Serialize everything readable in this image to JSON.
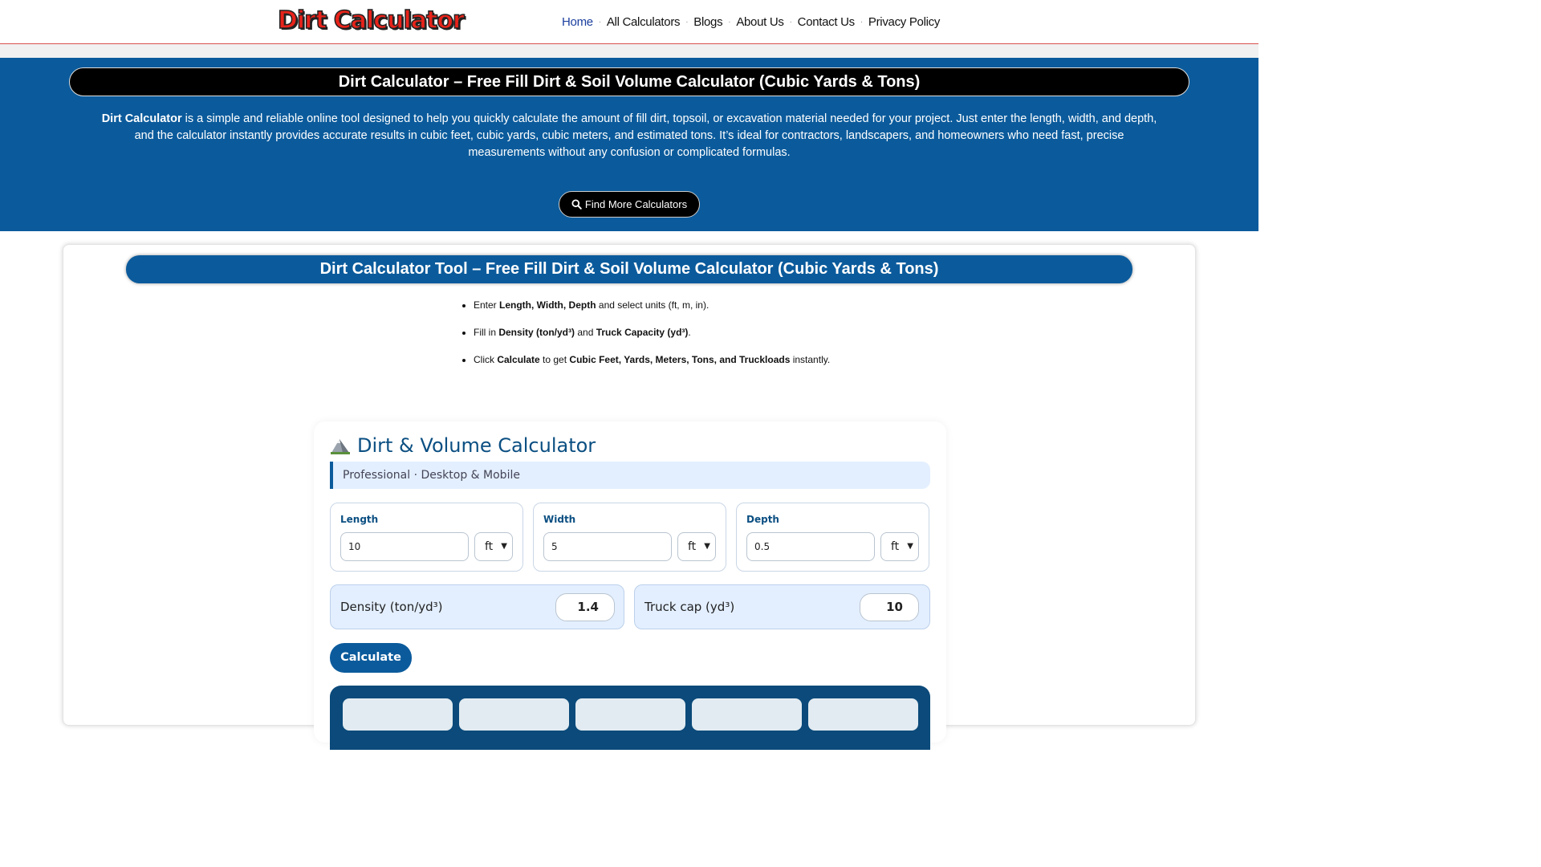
{
  "header": {
    "logo_text": "Dirt Calculator",
    "nav": [
      "Home",
      "All Calculators",
      "Blogs",
      "About Us",
      "Contact Us",
      "Privacy Policy"
    ],
    "nav_active": "Home",
    "nav_separator": "·"
  },
  "hero": {
    "title": "Dirt Calculator – Free Fill Dirt & Soil Volume Calculator (Cubic Yards & Tons)",
    "intro_bold": "Dirt Calculator",
    "intro_rest": " is a simple and reliable online tool designed to help you quickly calculate the amount of fill dirt, topsoil, or excavation material needed for your project. Just enter the length, width, and depth, and the calculator instantly provides accurate results in cubic feet, cubic yards, cubic meters, and estimated tons. It’s ideal for contractors, landscapers, and homeowners who need fast, precise measurements without any confusion or complicated formulas.",
    "find_button": "Find More Calculators",
    "find_icon": "search-icon"
  },
  "tool": {
    "title": "Dirt Calculator Tool – Free Fill Dirt & Soil Volume Calculator (Cubic Yards & Tons)",
    "steps": [
      {
        "a": "Enter ",
        "b": "Length, Width, Depth",
        "c": " and select units (ft, m, in).",
        "d": "",
        "e": ""
      },
      {
        "a": "Fill in ",
        "b": "Density (ton/yd³)",
        "c": " and ",
        "d": "Truck Capacity (yd³)",
        "e": "."
      },
      {
        "a": "Click ",
        "b": "Calculate",
        "c": " to get ",
        "d": "Cubic Feet, Yards, Meters, Tons, and Truckloads",
        "e": " instantly."
      }
    ]
  },
  "calculator": {
    "icon": "mountain-icon",
    "title": "Dirt & Volume Calculator",
    "subtitle": "Professional · Desktop & Mobile",
    "length": {
      "label": "Length",
      "value": "10",
      "unit": "ft"
    },
    "width": {
      "label": "Width",
      "value": "5",
      "unit": "ft"
    },
    "depth": {
      "label": "Depth",
      "value": "0.5",
      "unit": "ft"
    },
    "density": {
      "label": "Density (ton/yd³)",
      "value": "1.4"
    },
    "truck": {
      "label": "Truck cap (yd³)",
      "value": "10"
    },
    "calculate": "Calculate"
  },
  "colors": {
    "brand_blue": "#0b5b9c",
    "dark_blue": "#0b4a7a",
    "logo_red": "#e8231a",
    "nav_active": "#1b3f9e"
  }
}
